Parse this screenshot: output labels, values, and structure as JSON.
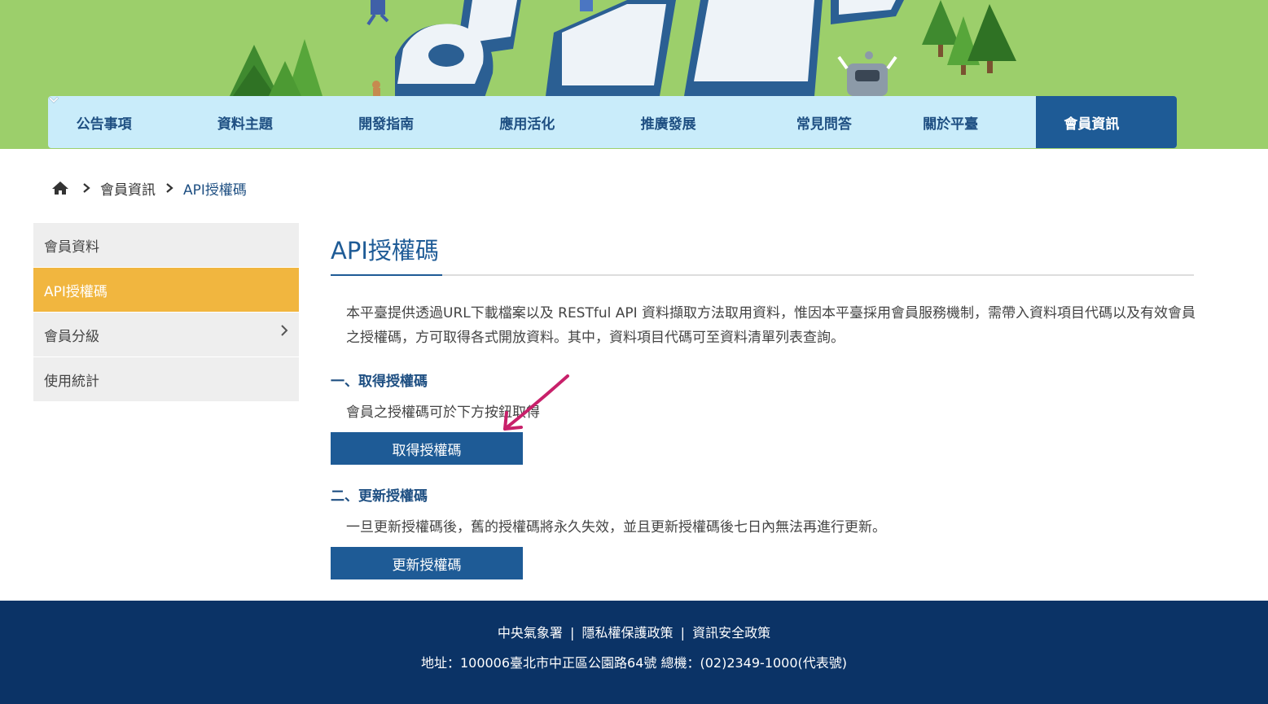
{
  "nav": {
    "items": [
      {
        "label": "公告事項",
        "has_dropdown": true
      },
      {
        "label": "資料主題",
        "has_dropdown": true
      },
      {
        "label": "開發指南",
        "has_dropdown": true
      },
      {
        "label": "應用活化",
        "has_dropdown": true
      },
      {
        "label": "推廣發展",
        "has_dropdown": true
      },
      {
        "label": "常見問答",
        "has_dropdown": false
      },
      {
        "label": "關於平臺",
        "has_dropdown": true
      },
      {
        "label": "會員資訊",
        "has_dropdown": true,
        "active": true
      }
    ]
  },
  "breadcrumb": {
    "home_icon": "home-icon",
    "items": [
      "會員資訊",
      "API授權碼"
    ]
  },
  "sidebar": {
    "items": [
      {
        "label": "會員資料"
      },
      {
        "label": "API授權碼",
        "active": true
      },
      {
        "label": "會員分級",
        "has_submenu": true
      },
      {
        "label": "使用統計"
      }
    ]
  },
  "main": {
    "title": "API授權碼",
    "intro": "本平臺提供透過URL下載檔案以及 RESTful API 資料擷取方法取用資料，惟因本平臺採用會員服務機制，需帶入資料項目代碼以及有效會員之授權碼，方可取得各式開放資料。其中，資料項目代碼可至資料清單列表查詢。",
    "section1": {
      "heading": "一、取得授權碼",
      "text": "會員之授權碼可於下方按鈕取得",
      "button": "取得授權碼"
    },
    "section2": {
      "heading": "二、更新授權碼",
      "text": "一旦更新授權碼後，舊的授權碼將永久失效，並且更新授權碼後七日內無法再進行更新。",
      "button": "更新授權碼"
    }
  },
  "footer": {
    "links": [
      "中央氣象署",
      "隱私權保護政策",
      "資訊安全政策"
    ],
    "separator": "|",
    "address": "地址：100006臺北市中正區公園路64號 總機：(02)2349-1000(代表號)"
  },
  "colors": {
    "hero_green": "#9ccf6b",
    "nav_bg": "#c9ecfa",
    "nav_active": "#1e5b96",
    "sidebar_active": "#f1b63f",
    "primary_blue": "#1e5b96",
    "footer_bg": "#0b3366",
    "annotation_arrow": "#c8206a"
  }
}
